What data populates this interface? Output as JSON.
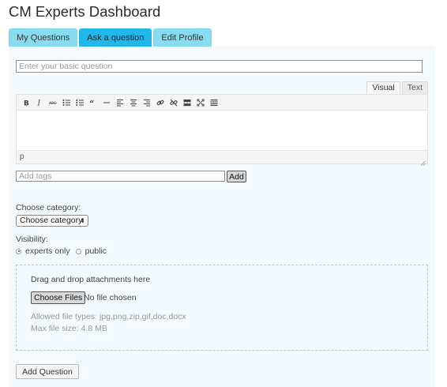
{
  "header": {
    "title": "CM Experts Dashboard"
  },
  "tabs": [
    {
      "label": "My Questions",
      "active": false
    },
    {
      "label": "Ask a question",
      "active": true
    },
    {
      "label": "Edit Profile",
      "active": false
    }
  ],
  "question": {
    "placeholder": "Enter your basic question"
  },
  "editor": {
    "modes": [
      "Visual",
      "Text"
    ],
    "active_mode": "Visual",
    "path": "p",
    "toolbar": [
      "bold-icon",
      "italic-icon",
      "strikethrough-icon",
      "bullet-list-icon",
      "numbered-list-icon",
      "blockquote-icon",
      "horizontal-rule-icon",
      "align-left-icon",
      "align-center-icon",
      "align-right-icon",
      "link-icon",
      "unlink-icon",
      "read-more-icon",
      "fullscreen-icon",
      "toolbar-toggle-icon"
    ]
  },
  "tags": {
    "placeholder": "Add tags",
    "add_label": "Add"
  },
  "category": {
    "label": "Choose category:",
    "selected": "Choose category"
  },
  "visibility": {
    "label": "Visibility:",
    "options": [
      {
        "label": "experts only",
        "checked": true
      },
      {
        "label": "public",
        "checked": false
      }
    ]
  },
  "attachments": {
    "hint": "Drag and drop attachments here",
    "choose_label": "Choose Files",
    "status": "No file chosen",
    "allowed": "Allowed file types: jpg,png,zip,gif,doc,docx",
    "max_size": "Max file size: 4.8 MB"
  },
  "submit": {
    "label": "Add Question"
  },
  "colors": {
    "tab": "#88dcf0",
    "tab_active": "#22b7ea",
    "panel_bg": "#f3f9fd"
  }
}
